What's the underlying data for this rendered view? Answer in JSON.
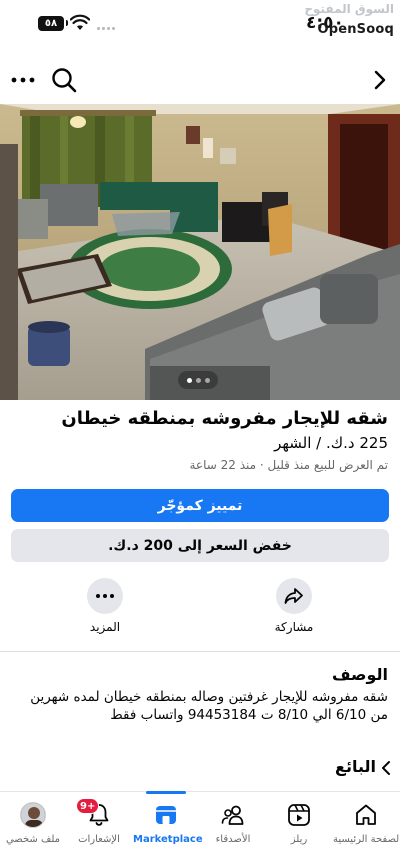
{
  "status_bar": {
    "time": "٤:٥٠",
    "battery": "٥٨",
    "brand": "OpenSooq",
    "brand_ar": "السوق المفتوح"
  },
  "listing": {
    "title": "شقه للإيجار مفروشه بمنطقه خيطان",
    "price": "225 د.ك. / الشهر",
    "listed": "تم العرض للبيع منذ قليل · منذ 22 ساعة",
    "photo_count": 3,
    "photo_active": 1
  },
  "buttons": {
    "boost": "تمييز كمؤجّر",
    "reduce_price": "خفض السعر إلى 200 د.ك."
  },
  "actions": {
    "share": "مشاركة",
    "more": "المزيد"
  },
  "description": {
    "heading": "الوصف",
    "text": "شقه مفروشه للإيجار غرفتين وصاله بمنطقه خيطان لمده شهرين من 6/10 الي 8/10 ت 94453184 واتساب فقط"
  },
  "seller": {
    "heading": "البائع"
  },
  "tabs": {
    "home": "الصفحة الرئيسية",
    "reels": "ريلز",
    "friends": "الأصدقاء",
    "marketplace": "Marketplace",
    "notifications": "الإشعارات",
    "notifications_badge": "9+",
    "profile": "ملف شخصي"
  },
  "colors": {
    "accent": "#1877f2",
    "secondary_button": "#e4e6eb",
    "badge": "#e41e3f",
    "muted_text": "#65676b"
  }
}
